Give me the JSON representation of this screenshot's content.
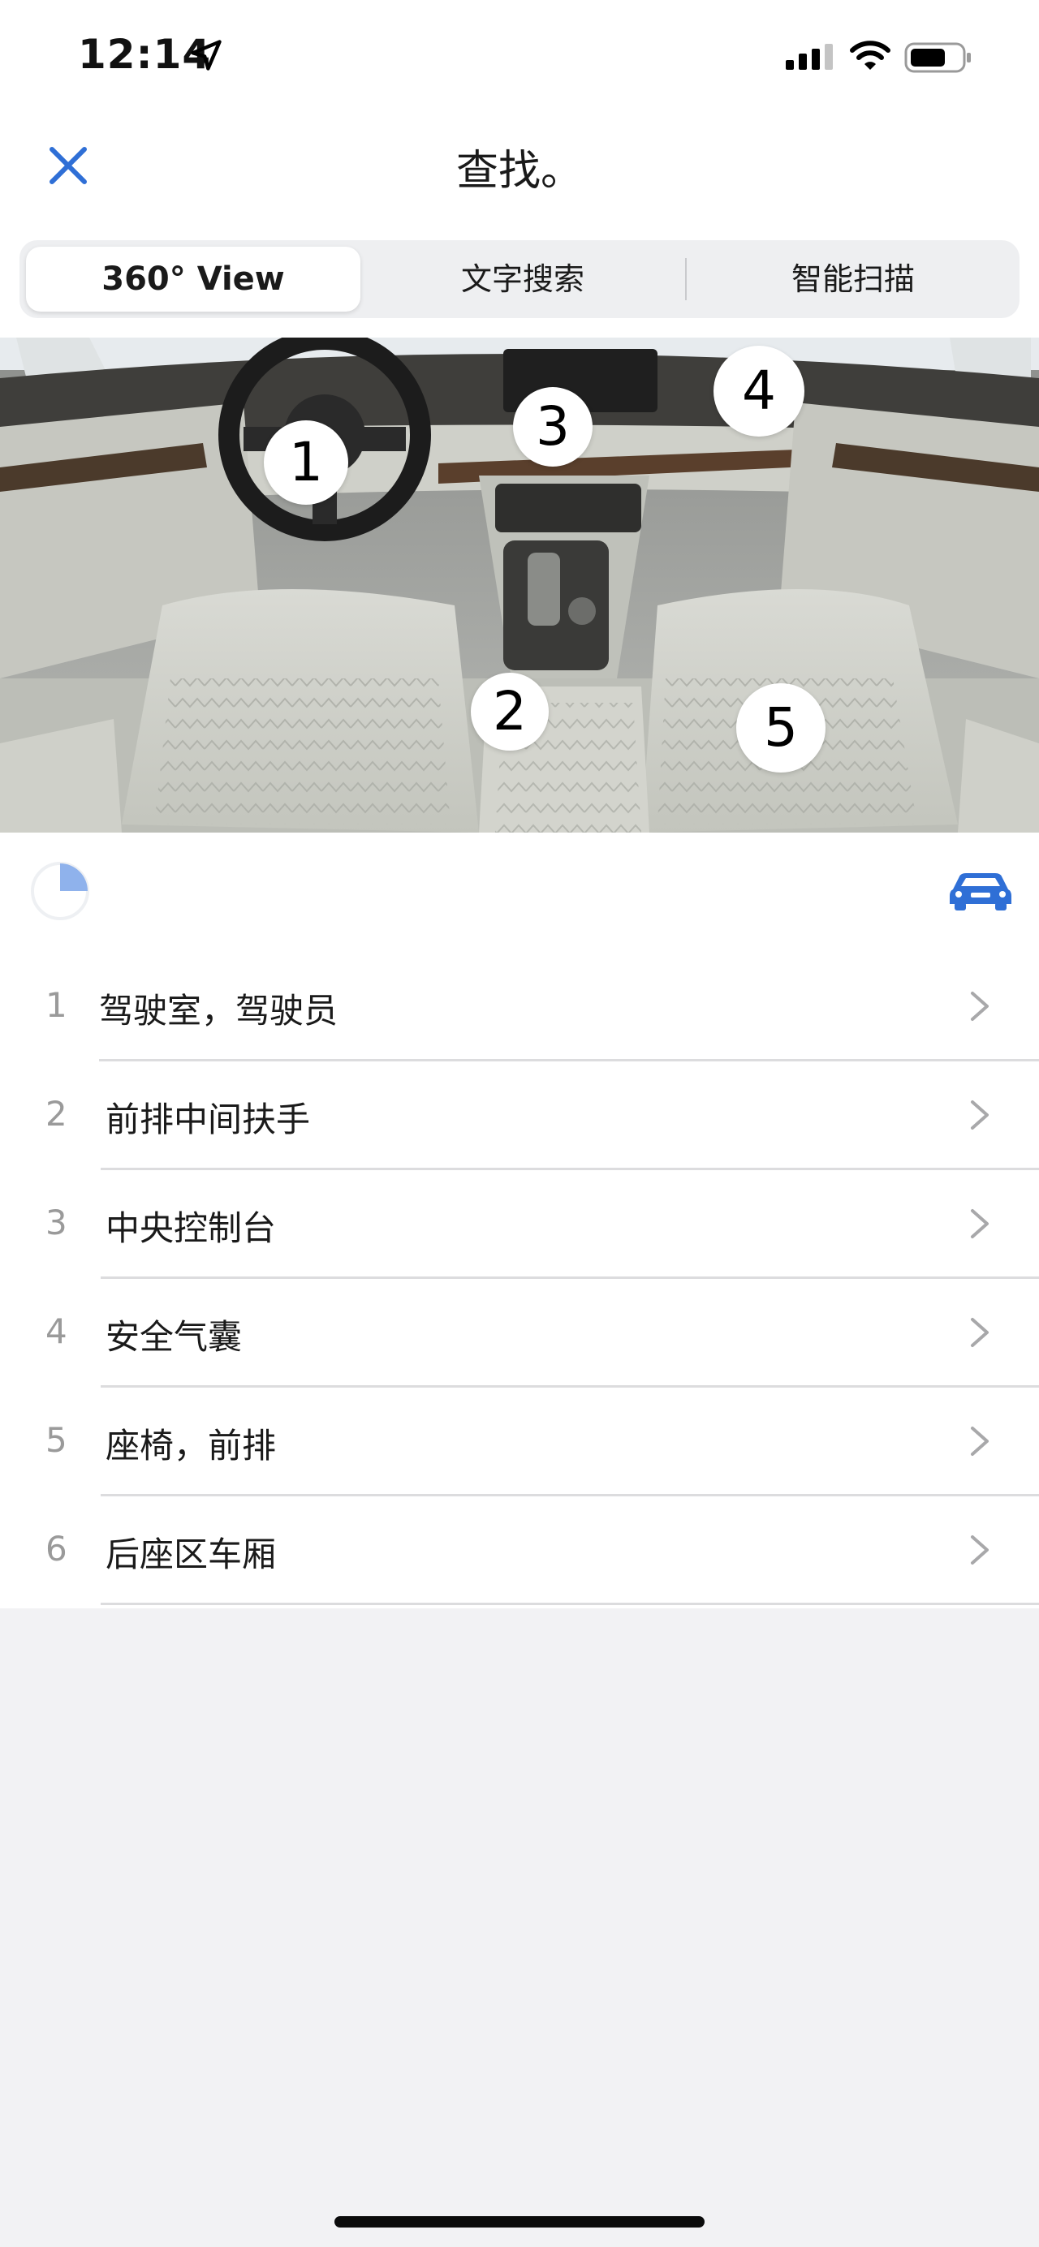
{
  "status_bar": {
    "time": "12:14"
  },
  "header": {
    "title": "查找。"
  },
  "tabs": [
    {
      "label": "360° View",
      "active": true
    },
    {
      "label": "文字搜索",
      "active": false
    },
    {
      "label": "智能扫描",
      "active": false
    }
  ],
  "hotspots": [
    "1",
    "2",
    "3",
    "4",
    "5"
  ],
  "list": [
    {
      "num": "1",
      "label": "驾驶室，驾驶员"
    },
    {
      "num": "2",
      "label": "前排中间扶手"
    },
    {
      "num": "3",
      "label": "中央控制台"
    },
    {
      "num": "4",
      "label": "安全气囊"
    },
    {
      "num": "5",
      "label": "座椅，前排"
    },
    {
      "num": "6",
      "label": "后座区车厢"
    }
  ],
  "colors": {
    "accent": "#2f6fd6",
    "spinner": "#8fb2ec"
  },
  "icons": {
    "close": "close-icon",
    "location": "location-arrow-icon",
    "car": "car-icon",
    "spinner": "loading-spinner-icon",
    "chevron": "chevron-right-icon"
  }
}
